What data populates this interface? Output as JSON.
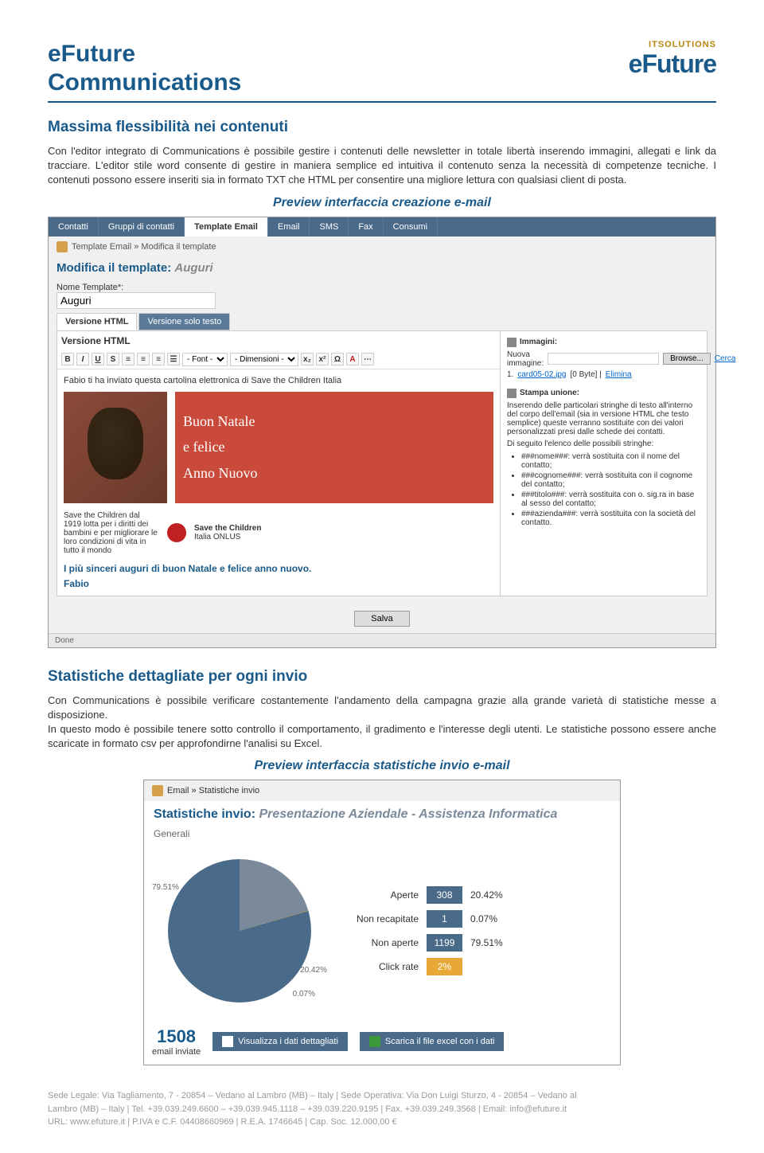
{
  "header": {
    "title_line1": "eFuture",
    "title_line2": "Communications",
    "logo_tag": "ITSOLUTIONS",
    "logo_main": "eFuture"
  },
  "section1": {
    "title": "Massima flessibilità nei contenuti",
    "text": "Con l'editor integrato di Communications è possibile gestire i contenuti delle newsletter in totale libertà inserendo immagini, allegati e link da tracciare. L'editor stile word consente di gestire in maniera semplice ed intuitiva il contenuto senza la necessità di competenze tecniche. I contenuti possono essere inseriti sia in formato TXT che HTML per consentire una migliore lettura con qualsiasi client di posta.",
    "preview_title": "Preview interfaccia creazione e-mail"
  },
  "editor": {
    "tabs": [
      "Contatti",
      "Gruppi di contatti",
      "Template Email",
      "Email",
      "SMS",
      "Fax",
      "Consumi"
    ],
    "breadcrumb": "Template Email » Modifica il template",
    "title_prefix": "Modifica il template: ",
    "title_name": "Auguri",
    "name_label": "Nome Template*:",
    "name_value": "Auguri",
    "subtabs": [
      "Versione HTML",
      "Versione solo testo"
    ],
    "version_label": "Versione HTML",
    "toolbar_font": "- Font -",
    "toolbar_size": "- Dimensioni -",
    "content_line1": "Fabio ti ha inviato questa cartolina elettronica di Save the Children Italia",
    "postcard_l1": "Buon Natale",
    "postcard_l2": "e felice",
    "postcard_l3": "Anno Nuovo",
    "stc_text": "Save the Children dal 1919 lotta per i diritti dei bambini e per migliorare le loro condizioni di vita in tutto il mondo",
    "stc_name": "Save the Children",
    "stc_sub": "Italia ONLUS",
    "msg1": "I più sinceri auguri di buon Natale e felice anno nuovo.",
    "msg2": "Fabio",
    "right": {
      "img_title": "Immagini:",
      "img_label": "Nuova immagine:",
      "browse": "Browse...",
      "search": "Cerca",
      "file_num": "1.",
      "file_name": "card05-02.jpg",
      "file_size": "[0 Byte] |",
      "file_del": "Elimina",
      "merge_title": "Stampa unione:",
      "merge_text": "Inserendo delle particolari stringhe di testo all'interno del corpo dell'email (sia in versione HTML che testo semplice) queste verranno sostituite con dei valori personalizzati presi dalle schede dei contatti.",
      "merge_text2": "Di seguito l'elenco delle possibili stringhe:",
      "merge_items": [
        "###nome###: verrà sostituita con il nome del contatto;",
        "###cognome###: verrà sostituita con il cognome del contatto;",
        "###titolo###: verrà sostituita con o. sig.ra in base al sesso del contatto;",
        "###azienda###: verrà sostituita con la società del contatto."
      ]
    },
    "save": "Salva",
    "status": "Done"
  },
  "section2": {
    "title": "Statistiche dettagliate per ogni invio",
    "text": "Con Communications è possibile verificare costantemente l'andamento della campagna grazie alla grande varietà di statistiche messe a disposizione.\nIn questo modo è possibile tenere sotto controllo il comportamento, il gradimento e l'interesse degli utenti. Le statistiche possono essere anche scaricate in formato csv per approfondirne l'analisi su Excel.",
    "preview_title": "Preview interfaccia statistiche invio e-mail"
  },
  "stats": {
    "breadcrumb": "Email » Statistiche invio",
    "title_prefix": "Statistiche invio: ",
    "title_name": "Presentazione Aziendale - Assistenza Informatica",
    "sub": "Generali",
    "pie_labels": {
      "p1": "79.51%",
      "p2": "20.42%",
      "p3": "0.07%"
    },
    "rows": [
      {
        "label": "Aperte",
        "value": "308",
        "pct": "20.42%",
        "cls": ""
      },
      {
        "label": "Non recapitate",
        "value": "1",
        "pct": "0.07%",
        "cls": ""
      },
      {
        "label": "Non aperte",
        "value": "1199",
        "pct": "79.51%",
        "cls": ""
      },
      {
        "label": "Click rate",
        "value": "2%",
        "pct": "",
        "cls": "orange"
      }
    ],
    "total": "1508",
    "total_label": "email inviate",
    "btn1": "Visualizza i dati dettagliati",
    "btn2": "Scarica il file excel con i dati"
  },
  "chart_data": {
    "type": "pie",
    "title": "Statistiche invio email",
    "series": [
      {
        "name": "Non aperte",
        "value": 1199,
        "pct": 79.51,
        "color": "#4a6a8a"
      },
      {
        "name": "Aperte",
        "value": 308,
        "pct": 20.42,
        "color": "#7a8a9a"
      },
      {
        "name": "Non recapitate",
        "value": 1,
        "pct": 0.07,
        "color": "#e8a838"
      }
    ],
    "total": 1508,
    "click_rate_pct": 2
  },
  "footer": {
    "l1": "Sede Legale: Via Tagliamento, 7 - 20854 – Vedano al Lambro (MB) – Italy | Sede Operativa: Via Don Luigi Sturzo, 4 - 20854 – Vedano al",
    "l2": "Lambro (MB) – Italy | Tel. +39.039.249.6600 – +39.039.945.1118 – +39.039.220.9195 | Fax. +39.039.249.3568 | Email: info@efuture.it",
    "l3": "URL: www.efuture.it | P.IVA e C.F. 04408660969 | R.E.A. 1746645 | Cap. Soc. 12.000,00 €"
  }
}
